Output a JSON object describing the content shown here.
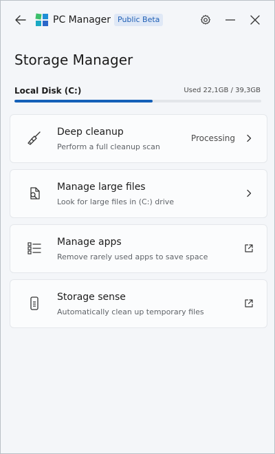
{
  "app": {
    "title": "PC Manager",
    "badge": "Public Beta"
  },
  "icons": {
    "back": "arrow-left-icon",
    "settings": "gear-icon",
    "minimize": "minimize-icon",
    "close": "close-icon"
  },
  "page": {
    "title": "Storage Manager"
  },
  "disk": {
    "label": "Local Disk (C:)",
    "usage_text": "Used 22,1GB / 39,3GB",
    "used_fraction": 0.56
  },
  "colors": {
    "accent": "#1460b8",
    "badge_bg": "#dfe8f6"
  },
  "cards": [
    {
      "title": "Deep cleanup",
      "description": "Perform a full cleanup scan",
      "status": "Processing",
      "icon": "broom-icon",
      "action_icon": "chevron-right-icon"
    },
    {
      "title": "Manage large files",
      "description": "Look for large files in (C:) drive",
      "status": "",
      "icon": "file-search-icon",
      "action_icon": "chevron-right-icon"
    },
    {
      "title": "Manage apps",
      "description": "Remove rarely used apps to save space",
      "status": "",
      "icon": "app-list-icon",
      "action_icon": "open-external-icon"
    },
    {
      "title": "Storage sense",
      "description": "Automatically clean up temporary files",
      "status": "",
      "icon": "phone-storage-icon",
      "action_icon": "open-external-icon"
    }
  ]
}
